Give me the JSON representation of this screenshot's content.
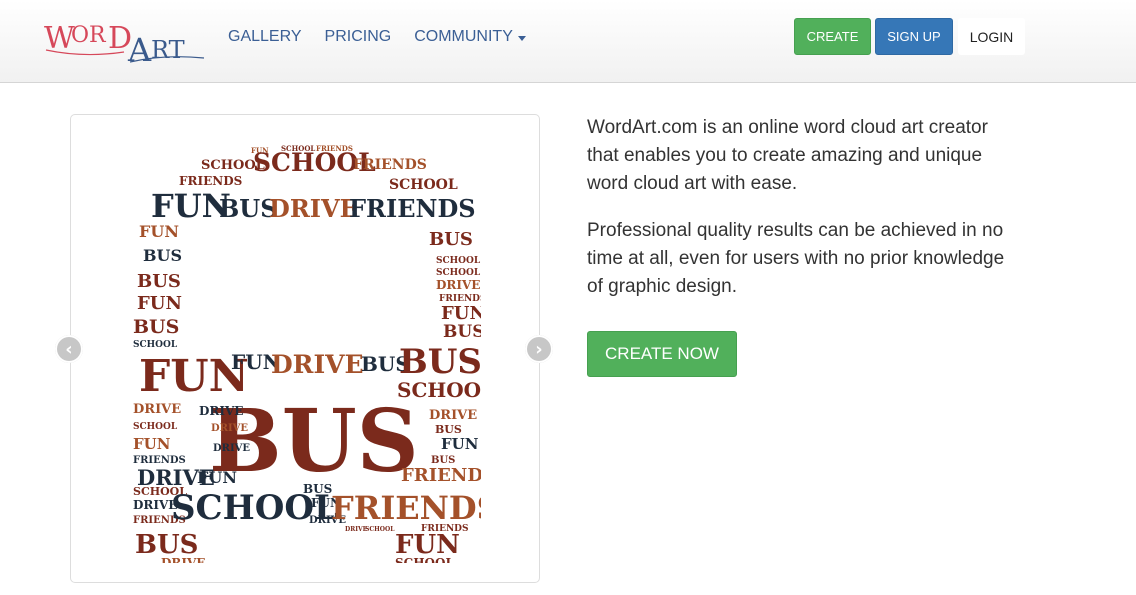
{
  "header": {
    "logo_text": "WordArt",
    "nav": [
      {
        "label": "GALLERY"
      },
      {
        "label": "PRICING"
      },
      {
        "label": "COMMUNITY"
      }
    ],
    "buttons": {
      "create": "CREATE",
      "signup": "SIGN UP",
      "login": "LOGIN"
    }
  },
  "carousel": {
    "prev_icon": "chevron-left-icon",
    "next_icon": "chevron-right-icon",
    "words": [
      "SCHOOL",
      "FRIENDS",
      "FUN",
      "BUS",
      "DRIVE"
    ]
  },
  "intro": {
    "paragraph_1": "WordArt.com is an online word cloud art creator that enables you to create amazing and unique word cloud art with ease.",
    "paragraph_2": "Professional quality results can be achieved in no time at all, even for users with no prior knowledge of graphic design.",
    "cta": "CREATE NOW"
  },
  "colors": {
    "link": "#3b5f95",
    "green": "#51b05b",
    "blue": "#3677b7",
    "word_dark": "#1f2d3d",
    "word_red": "#7b2a1c",
    "word_orange": "#a4512a"
  }
}
